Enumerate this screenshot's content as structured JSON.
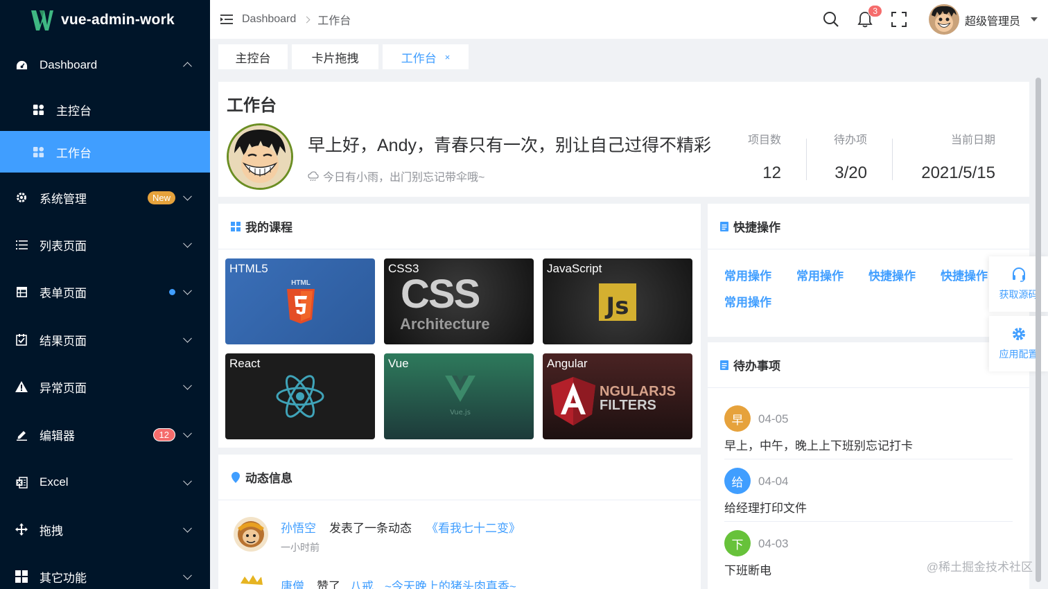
{
  "app": {
    "title": "vue-admin-work"
  },
  "sidebar": {
    "items": [
      {
        "label": "Dashboard",
        "icon": "dashboard-icon"
      },
      {
        "label": "主控台",
        "icon": "grid-icon"
      },
      {
        "label": "工作台",
        "icon": "grid-icon"
      },
      {
        "label": "系统管理",
        "icon": "gear-icon",
        "badge": "New"
      },
      {
        "label": "列表页面",
        "icon": "list-icon"
      },
      {
        "label": "表单页面",
        "icon": "table-icon"
      },
      {
        "label": "结果页面",
        "icon": "checkbox-icon"
      },
      {
        "label": "异常页面",
        "icon": "warning-icon"
      },
      {
        "label": "编辑器",
        "icon": "edit-icon",
        "badge": "12"
      },
      {
        "label": "Excel",
        "icon": "excel-icon"
      },
      {
        "label": "拖拽",
        "icon": "move-icon"
      },
      {
        "label": "其它功能",
        "icon": "apps-icon"
      }
    ]
  },
  "header": {
    "breadcrumb": [
      "Dashboard",
      "工作台"
    ],
    "notification_count": "3",
    "user_name": "超级管理员"
  },
  "tabs": [
    {
      "label": "主控台"
    },
    {
      "label": "卡片拖拽"
    },
    {
      "label": "工作台",
      "close": "×"
    }
  ],
  "workplace": {
    "title": "工作台",
    "greeting": "早上好，Andy，青春只有一次，别让自己过得不精彩",
    "weather": "今日有小雨，出门别忘记带伞哦~",
    "stats": [
      {
        "label": "项目数",
        "value": "12"
      },
      {
        "label": "待办项",
        "value": "3/20"
      },
      {
        "label": "当前日期",
        "value": "2021/5/15"
      }
    ]
  },
  "courses": {
    "title": "我的课程",
    "items": [
      {
        "label": "HTML5",
        "art": "HTML"
      },
      {
        "label": "CSS3",
        "art": "CSS",
        "art2": "Architecture"
      },
      {
        "label": "JavaScript",
        "art": "Js"
      },
      {
        "label": "React"
      },
      {
        "label": "Vue",
        "art": "Vue.js"
      },
      {
        "label": "Angular",
        "art": "NGULARJS",
        "art2": "FILTERS"
      }
    ]
  },
  "quick": {
    "title": "快捷操作",
    "links": [
      "常用操作",
      "常用操作",
      "快捷操作",
      "快捷操作",
      "常用操作"
    ]
  },
  "todo": {
    "title": "待办事项",
    "items": [
      {
        "char": "早",
        "date": "04-05",
        "text": "早上，中午，晚上上下班别忘记打卡",
        "color": "#e6a23c"
      },
      {
        "char": "给",
        "date": "04-04",
        "text": "给经理打印文件",
        "color": "#409eff"
      },
      {
        "char": "下",
        "date": "04-03",
        "text": "下班断电",
        "color": "#67c23a"
      }
    ]
  },
  "dynamic": {
    "title": "动态信息",
    "items": [
      {
        "user": "孙悟空",
        "action": "发表了一条动态",
        "target": "《看我七十二变》",
        "time": "一小时前"
      },
      {
        "user": "唐僧",
        "action": "赞了",
        "target2": "八戒",
        "target": "~今天晚上的猪头肉真香~"
      }
    ]
  },
  "floating": {
    "source_label": "获取源码",
    "config_label": "应用配置"
  },
  "watermark": "@稀土掘金技术社区",
  "colors": {
    "primary": "#409eff",
    "sidebar_bg": "#001529"
  }
}
